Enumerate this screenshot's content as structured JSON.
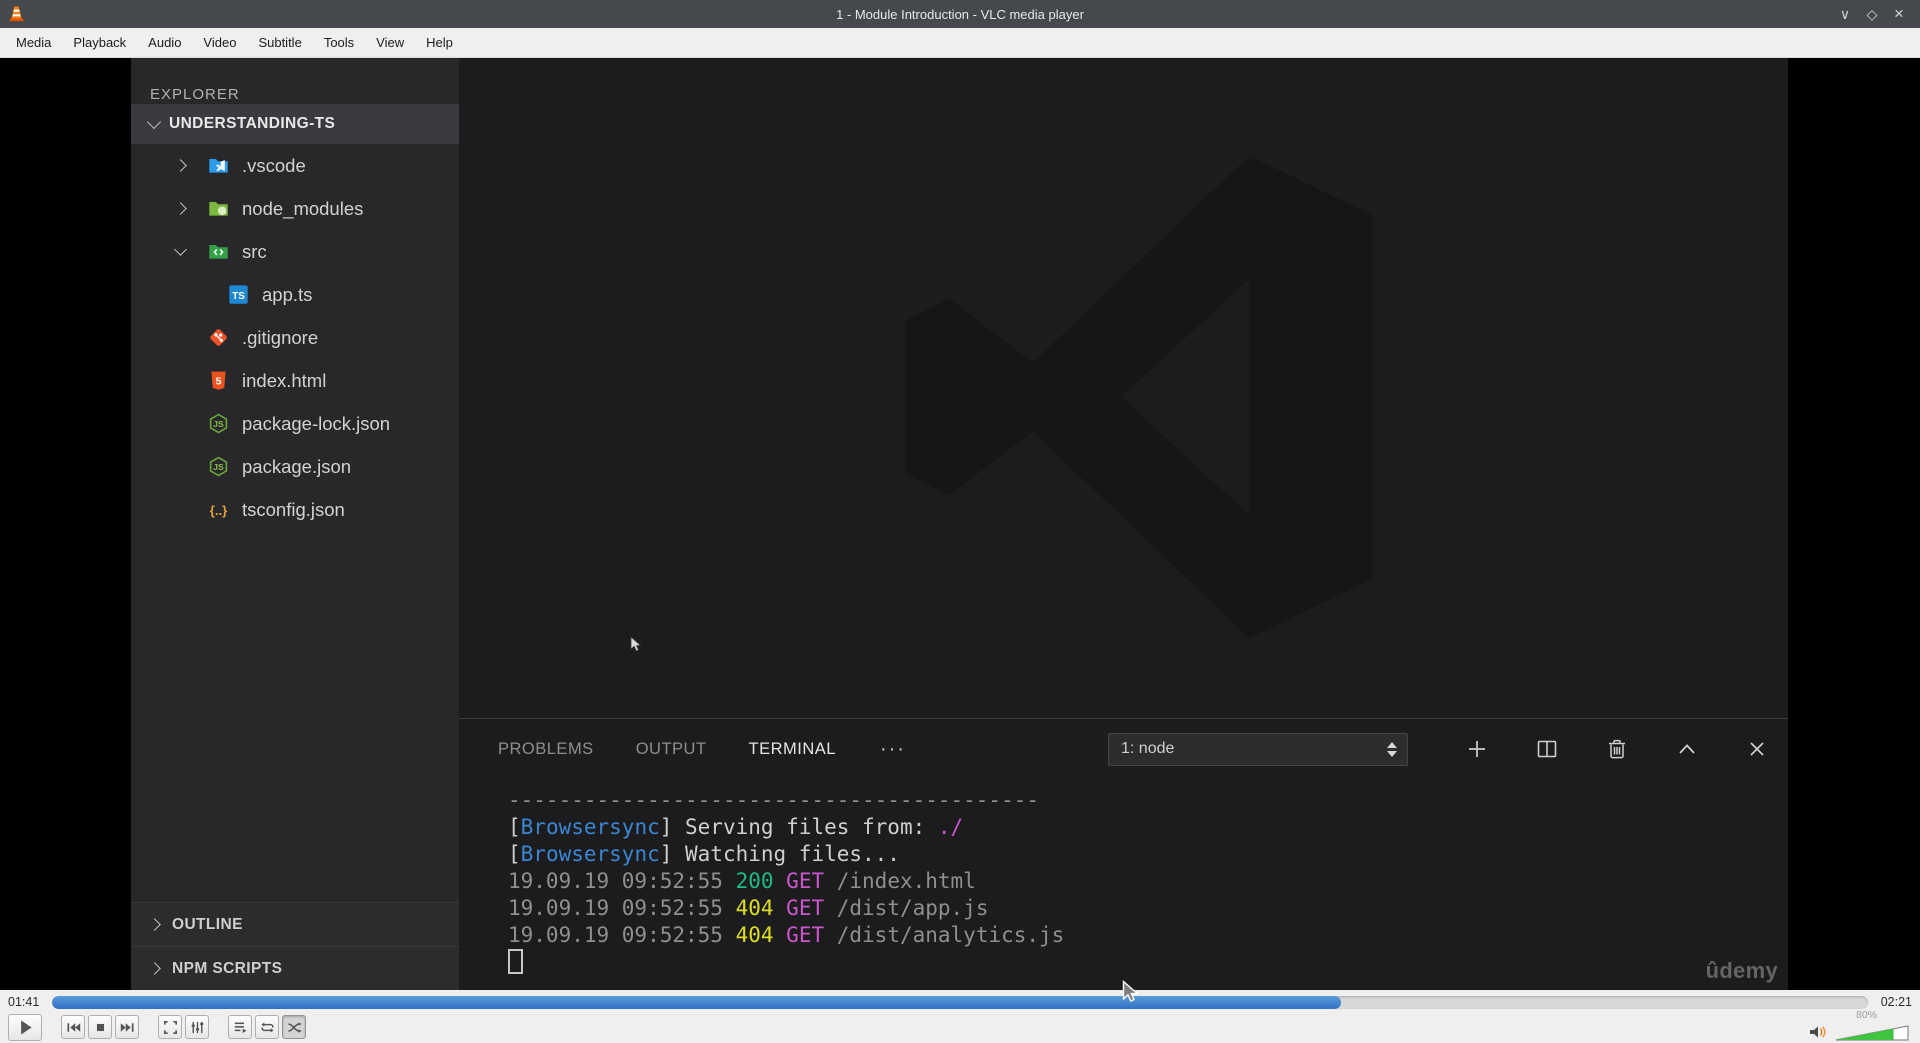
{
  "colors": {
    "accent": "#2f72c4",
    "accent_light": "#5b9bd8",
    "volume_green": "#3fc43f",
    "terminal": {
      "gray": "#8f8f8f",
      "white": "#cfcfcf",
      "blue": "#3a86d3",
      "green": "#1fba84",
      "yellow": "#dede21",
      "magenta": "#cc56cc"
    }
  },
  "titlebar": {
    "title": "1 - Module Introduction - VLC media player",
    "app_icon": "vlc-cone-icon",
    "minimize_glyph": "∨",
    "maximize_glyph": "◇",
    "close_glyph": "×"
  },
  "menubar": {
    "items": [
      "Media",
      "Playback",
      "Audio",
      "Video",
      "Subtitle",
      "Tools",
      "View",
      "Help"
    ]
  },
  "explorer": {
    "header": "EXPLORER",
    "root_label": "UNDERSTANDING-TS",
    "items": [
      {
        "label": ".vscode",
        "icon": "vscode-folder-icon",
        "chevron": "right",
        "indent": 0
      },
      {
        "label": "node_modules",
        "icon": "node-modules-folder-icon",
        "chevron": "right",
        "indent": 0
      },
      {
        "label": "src",
        "icon": "src-folder-icon",
        "chevron": "down",
        "indent": 0
      },
      {
        "label": "app.ts",
        "icon": "typescript-file-icon",
        "chevron": "none",
        "indent": 1
      },
      {
        "label": ".gitignore",
        "icon": "git-file-icon",
        "chevron": "none",
        "indent": 0
      },
      {
        "label": "index.html",
        "icon": "html-file-icon",
        "chevron": "none",
        "indent": 0
      },
      {
        "label": "package-lock.json",
        "icon": "node-file-icon",
        "chevron": "none",
        "indent": 0
      },
      {
        "label": "package.json",
        "icon": "node-file-icon",
        "chevron": "none",
        "indent": 0
      },
      {
        "label": "tsconfig.json",
        "icon": "tsconfig-file-icon",
        "chevron": "none",
        "indent": 0
      }
    ],
    "sections": [
      {
        "label": "OUTLINE"
      },
      {
        "label": "NPM SCRIPTS"
      }
    ]
  },
  "panel": {
    "tabs": [
      {
        "label": "PROBLEMS",
        "active": false
      },
      {
        "label": "OUTPUT",
        "active": false
      },
      {
        "label": "TERMINAL",
        "active": true
      }
    ],
    "overflow_glyph": "···",
    "terminal_select_value": "1: node",
    "terminal_lines": [
      {
        "segs": [
          {
            "t": "------------------------------------------",
            "c": "gray"
          }
        ]
      },
      {
        "segs": [
          {
            "t": "[",
            "c": "white"
          },
          {
            "t": "Browsersync",
            "c": "blue"
          },
          {
            "t": "] Serving files from: ",
            "c": "white"
          },
          {
            "t": "./",
            "c": "magenta"
          }
        ]
      },
      {
        "segs": [
          {
            "t": "[",
            "c": "white"
          },
          {
            "t": "Browsersync",
            "c": "blue"
          },
          {
            "t": "] Watching files...",
            "c": "white"
          }
        ]
      },
      {
        "segs": [
          {
            "t": "19.09.19 09:52:55 ",
            "c": "gray"
          },
          {
            "t": "200",
            "c": "green"
          },
          {
            "t": " ",
            "c": "gray"
          },
          {
            "t": "GET",
            "c": "magenta"
          },
          {
            "t": " /index.html",
            "c": "gray"
          }
        ]
      },
      {
        "segs": [
          {
            "t": "19.09.19 09:52:55 ",
            "c": "gray"
          },
          {
            "t": "404",
            "c": "yellow"
          },
          {
            "t": " ",
            "c": "gray"
          },
          {
            "t": "GET",
            "c": "magenta"
          },
          {
            "t": " /dist/app.js",
            "c": "gray"
          }
        ]
      },
      {
        "segs": [
          {
            "t": "19.09.19 09:52:55 ",
            "c": "gray"
          },
          {
            "t": "404",
            "c": "yellow"
          },
          {
            "t": " ",
            "c": "gray"
          },
          {
            "t": "GET",
            "c": "magenta"
          },
          {
            "t": " /dist/analytics.js",
            "c": "gray"
          }
        ]
      },
      {
        "segs": [],
        "cursor": true
      }
    ]
  },
  "watermark": "ûdemy",
  "player": {
    "elapsed": "01:41",
    "total": "02:21",
    "progress_pct": 71,
    "volume_pct": 80,
    "volume_label": "80%",
    "buttons": [
      "play",
      "previous",
      "stop",
      "next",
      "fullscreen",
      "extended-settings",
      "playlist",
      "loop",
      "random"
    ],
    "pressed_button": "random"
  }
}
